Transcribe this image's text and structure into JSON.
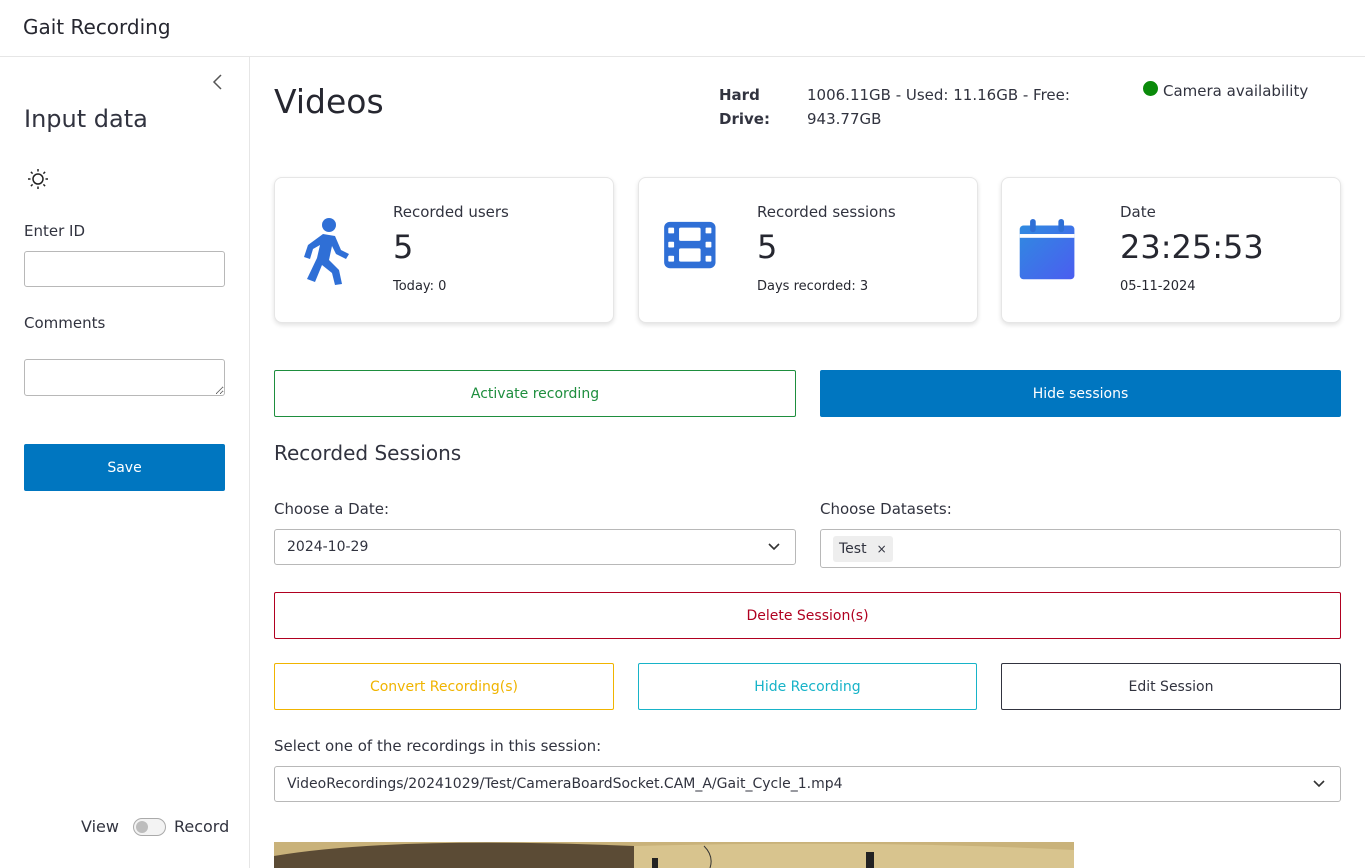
{
  "app": {
    "title": "Gait Recording"
  },
  "sidebar": {
    "title": "Input data",
    "id_label": "Enter ID",
    "id_value": "",
    "comments_label": "Comments",
    "comments_value": "",
    "save_label": "Save",
    "toggle": {
      "left_label": "View",
      "right_label": "Record",
      "on": false
    }
  },
  "main": {
    "title": "Videos",
    "hard_drive": {
      "label": "Hard Drive:",
      "value": "1006.11GB - Used: 11.16GB - Free: 943.77GB"
    },
    "camera": {
      "label": "Camera availability",
      "status_color": "#0a8a0a"
    },
    "cards": [
      {
        "label": "Recorded users",
        "value": "5",
        "sub": "Today: 0",
        "icon": "walking-person-icon",
        "color": "#2f6fd6"
      },
      {
        "label": "Recorded sessions",
        "value": "5",
        "sub": "Days recorded: 3",
        "icon": "film-icon",
        "color": "#2f6fd6"
      },
      {
        "label": "Date",
        "value": "23:25:53",
        "sub": "05-11-2024",
        "icon": "calendar-icon",
        "color": "#3b63e8"
      }
    ],
    "activate_label": "Activate recording",
    "hide_sessions_label": "Hide sessions",
    "section_title": "Recorded Sessions",
    "date_label": "Choose a Date:",
    "date_value": "2024-10-29",
    "datasets_label": "Choose Datasets:",
    "datasets_selected": [
      "Test"
    ],
    "delete_label": "Delete Session(s)",
    "convert_label": "Convert Recording(s)",
    "hide_recording_label": "Hide Recording",
    "edit_label": "Edit Session",
    "recording_label": "Select one of the recordings in this session:",
    "recording_value": "VideoRecordings/20241029/Test/CameraBoardSocket.CAM_A/Gait_Cycle_1.mp4"
  },
  "colors": {
    "primary": "#0076c0",
    "green": "#1e8e3e",
    "red": "#b00020",
    "yellow": "#f0b400",
    "cyan": "#17b3c8"
  }
}
